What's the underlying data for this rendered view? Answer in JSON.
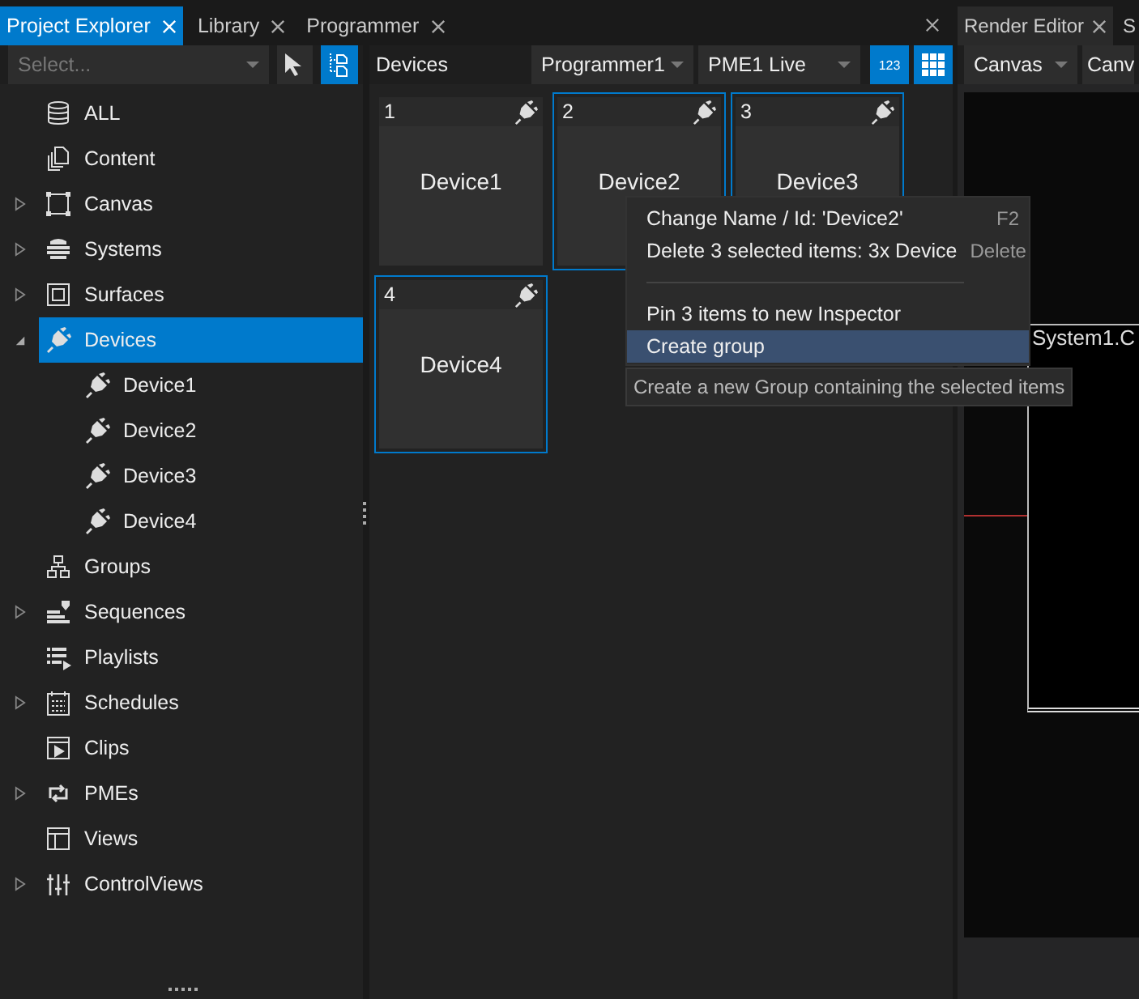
{
  "dock_tabs": [
    {
      "label": "Project Explorer",
      "selected": true
    },
    {
      "label": "Library",
      "selected": false
    },
    {
      "label": "Programmer",
      "selected": false
    }
  ],
  "explorer": {
    "select_placeholder": "Select...",
    "tree": [
      {
        "kind": "database",
        "label": "ALL",
        "selected": false
      },
      {
        "kind": "pages",
        "label": "Content",
        "selected": false
      },
      {
        "kind": "frame",
        "label": "Canvas",
        "expanded": false,
        "selected": false
      },
      {
        "kind": "server",
        "label": "Systems",
        "expanded": false,
        "selected": false
      },
      {
        "kind": "surface",
        "label": "Surfaces",
        "expanded": false,
        "selected": false
      },
      {
        "kind": "plug",
        "label": "Devices",
        "expanded": true,
        "selected": true,
        "children": [
          {
            "kind": "plug",
            "label": "Device1",
            "selected": false
          },
          {
            "kind": "plug",
            "label": "Device2",
            "selected": false
          },
          {
            "kind": "plug",
            "label": "Device3",
            "selected": false
          },
          {
            "kind": "plug",
            "label": "Device4",
            "selected": false
          }
        ]
      },
      {
        "kind": "hierarchy",
        "label": "Groups",
        "selected": false
      },
      {
        "kind": "sequence",
        "label": "Sequences",
        "expanded": false,
        "selected": false
      },
      {
        "kind": "playlist",
        "label": "Playlists",
        "selected": false
      },
      {
        "kind": "calendar",
        "label": "Schedules",
        "expanded": false,
        "selected": false
      },
      {
        "kind": "clip",
        "label": "Clips",
        "selected": false
      },
      {
        "kind": "cycle",
        "label": "PMEs",
        "expanded": false,
        "selected": false
      },
      {
        "kind": "layout",
        "label": "Views",
        "selected": false
      },
      {
        "kind": "sliders",
        "label": "ControlViews",
        "expanded": false,
        "selected": false
      }
    ]
  },
  "devices_panel": {
    "title": "Devices",
    "programmer": "Programmer1",
    "pme": "PME1 Live",
    "numbers_button": "123",
    "grid_view_on": true,
    "tiles": [
      {
        "number": "1",
        "name": "Device1",
        "selected": false
      },
      {
        "number": "2",
        "name": "Device2",
        "selected": true
      },
      {
        "number": "3",
        "name": "Device3",
        "selected": true
      },
      {
        "number": "4",
        "name": "Device4",
        "selected": true
      }
    ]
  },
  "context_menu": {
    "items": [
      {
        "kind": "item",
        "label": "Change Name / Id: 'Device2'",
        "shortcut": "F2",
        "highlighted": false
      },
      {
        "kind": "item",
        "label": "Delete 3 selected items: 3x Device",
        "shortcut": "Delete",
        "highlighted": false
      },
      {
        "kind": "separator"
      },
      {
        "kind": "item",
        "label": "Pin 3 items to new Inspector",
        "highlighted": false
      },
      {
        "kind": "item",
        "label": "Create group",
        "highlighted": true
      }
    ],
    "tooltip": "Create a new Group containing the selected items"
  },
  "render_editor": {
    "tabs": [
      {
        "label": "Render Editor",
        "selected": true
      },
      {
        "label": "S",
        "selected": false
      }
    ],
    "canvas_select": "Canvas",
    "second_select": "Canv",
    "canvas_label": "System1.C"
  }
}
